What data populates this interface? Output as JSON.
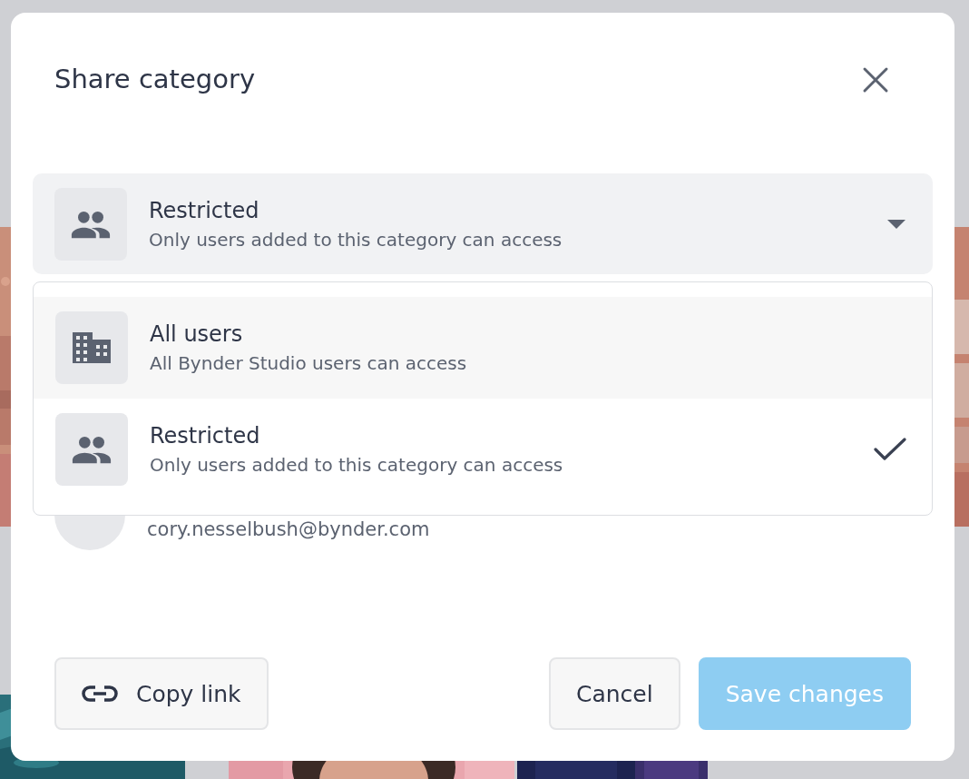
{
  "dialog": {
    "title": "Share category"
  },
  "access_select": {
    "kind": "people",
    "label": "Restricted",
    "description": "Only users added to this category can access",
    "expanded": true
  },
  "access_options": [
    {
      "kind": "building",
      "label": "All users",
      "description": "All Bynder Studio users can access",
      "highlighted": true,
      "selected": false
    },
    {
      "kind": "people",
      "label": "Restricted",
      "description": "Only users added to this category can access",
      "highlighted": false,
      "selected": true
    }
  ],
  "members": [
    {
      "email": "cory.nesselbush@bynder.com"
    }
  ],
  "footer": {
    "copy_link": "Copy link",
    "cancel": "Cancel",
    "save": {
      "label": "Save changes",
      "disabled": true
    }
  }
}
